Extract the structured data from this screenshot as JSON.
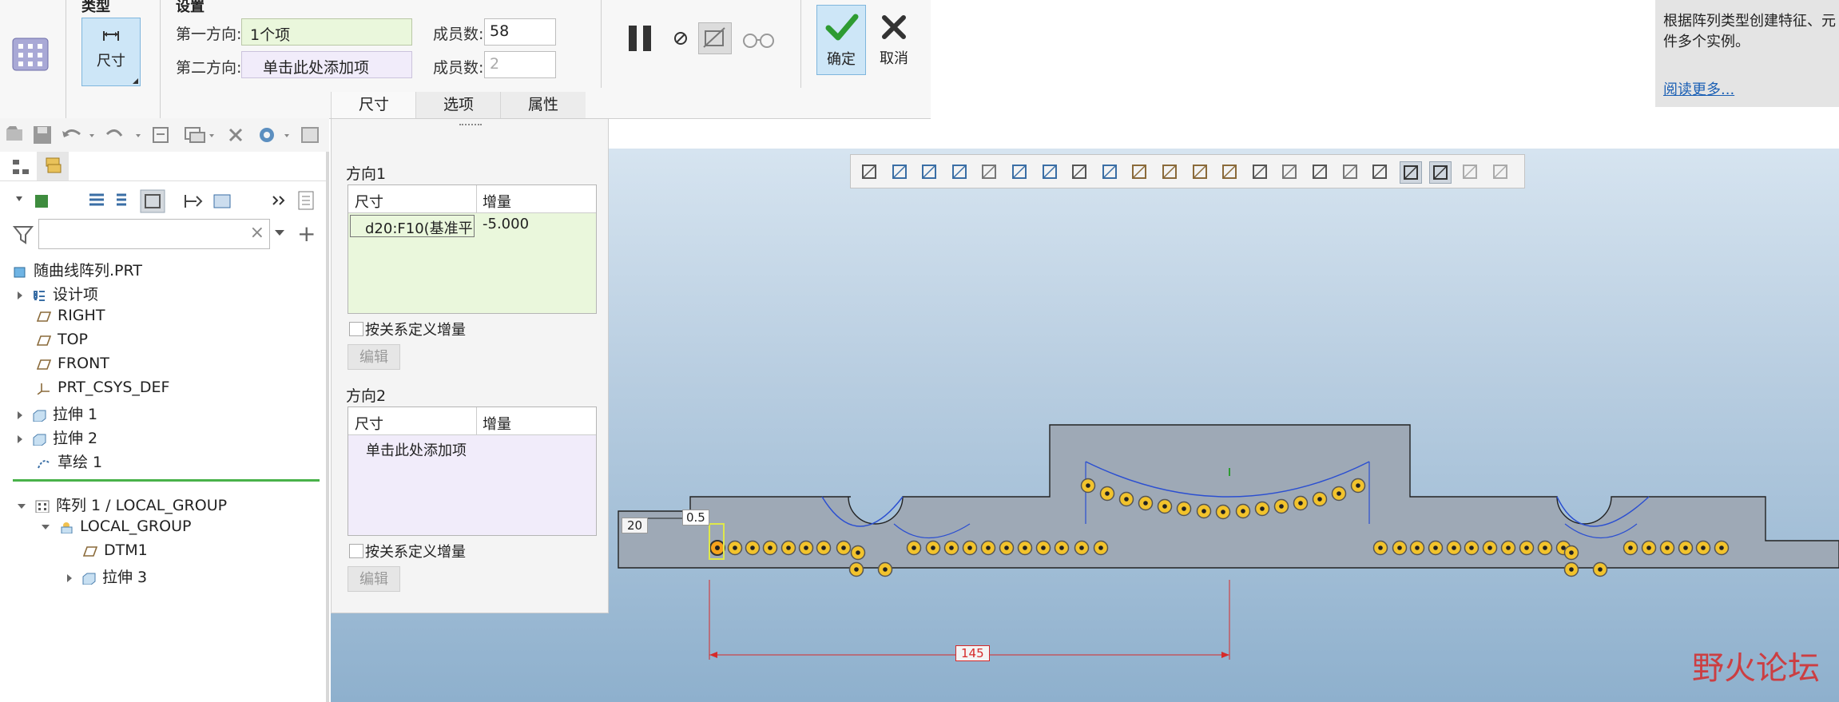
{
  "ribbon": {
    "type_group": {
      "title": "类型",
      "type_button": "尺寸"
    },
    "settings_group": {
      "title": "设置",
      "dir1_label": "第一方向:",
      "dir1_value": "1个项",
      "dir2_label": "第二方向:",
      "dir2_value": "单击此处添加项",
      "members1_label": "成员数:",
      "members1_value": "58",
      "members2_label": "成员数:",
      "members2_value": "2"
    },
    "ok_label": "确定",
    "cancel_label": "取消",
    "tabs": [
      "尺寸",
      "选项",
      "属性"
    ]
  },
  "help": {
    "text": "根据阵列类型创建特征、元件多个实例。",
    "link": "阅读更多..."
  },
  "dialog": {
    "dir1_title": "方向1",
    "col_dim": "尺寸",
    "col_inc": "增量",
    "row_dim": "d20:F10(基准平",
    "row_inc": "-5.000",
    "relation_check": "按关系定义增量",
    "edit_button": "编辑",
    "dir2_title": "方向2",
    "dir2_col_dim": "尺寸",
    "dir2_col_inc": "增量",
    "dir2_placeholder": "单击此处添加项",
    "relation_check2": "按关系定义增量",
    "edit_button2": "编辑"
  },
  "tree": {
    "root": "随曲线阵列.PRT",
    "items": [
      "设计项",
      "RIGHT",
      "TOP",
      "FRONT",
      "PRT_CSYS_DEF",
      "拉伸 1",
      "拉伸 2",
      "草绘 1"
    ],
    "pattern": "阵列 1 / LOCAL_GROUP",
    "group": "LOCAL_GROUP",
    "group_items": [
      "DTM1",
      "拉伸 3"
    ]
  },
  "canvas": {
    "dim_20": "20",
    "dim_05": "0.5",
    "dim_145": "145"
  },
  "watermark": "野火论坛",
  "colors": {
    "accent_green": "#2e9b32",
    "field_green": "#eaf7dc",
    "field_purple": "#f1ecfa",
    "link_blue": "#1a5fb4",
    "dim_red": "#d62a2a"
  }
}
